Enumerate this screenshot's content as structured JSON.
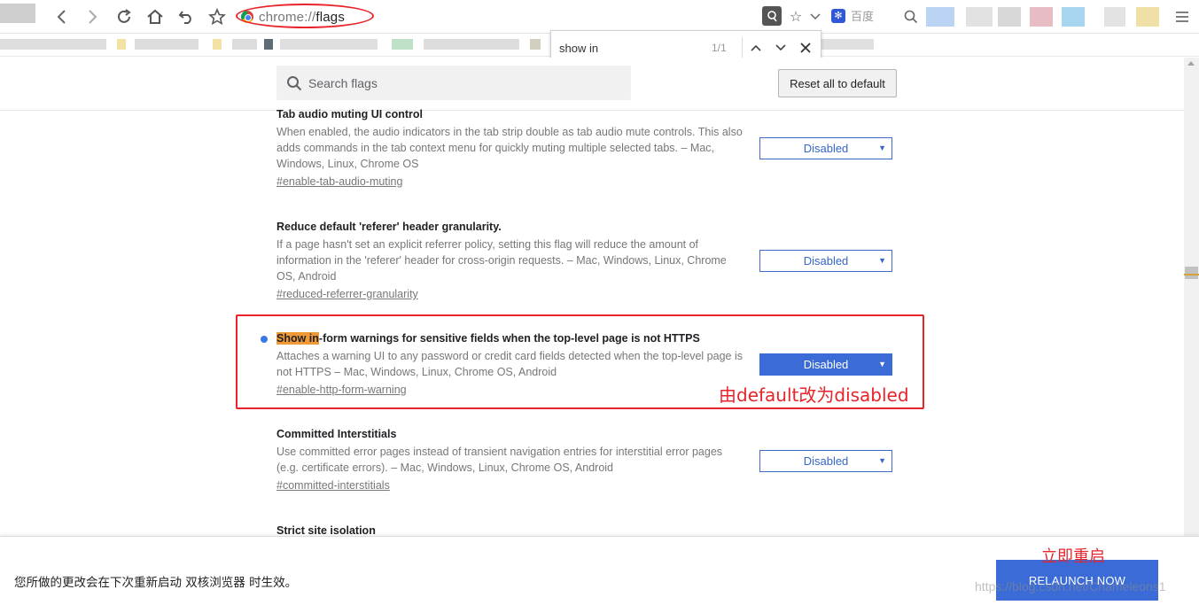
{
  "browser": {
    "url_scheme": "chrome://",
    "url_path": "flags",
    "search_engine": "百度"
  },
  "find_bar": {
    "query": "show in",
    "count": "1/1"
  },
  "header": {
    "search_placeholder": "Search flags",
    "reset_label": "Reset all to default"
  },
  "experiments": [
    {
      "title": "Tab audio muting UI control",
      "description": "When enabled, the audio indicators in the tab strip double as tab audio mute controls. This also adds commands in the tab context menu for quickly muting multiple selected tabs. – Mac, Windows, Linux, Chrome OS",
      "link": "#enable-tab-audio-muting",
      "value": "Disabled"
    },
    {
      "title": "Reduce default 'referer' header granularity.",
      "description": "If a page hasn't set an explicit referrer policy, setting this flag will reduce the amount of information in the 'referer' header for cross-origin requests. – Mac, Windows, Linux, Chrome OS, Android",
      "link": "#reduced-referrer-granularity",
      "value": "Disabled"
    },
    {
      "title_highlight": "Show in",
      "title_rest": "-form warnings for sensitive fields when the top-level page is not HTTPS",
      "description": "Attaches a warning UI to any password or credit card fields detected when the top-level page is not HTTPS – Mac, Windows, Linux, Chrome OS, Android",
      "link": "#enable-http-form-warning",
      "value": "Disabled"
    },
    {
      "title": "Committed Interstitials",
      "description": "Use committed error pages instead of transient navigation entries for interstitial error pages (e.g. certificate errors). – Mac, Windows, Linux, Chrome OS, Android",
      "link": "#committed-interstitials",
      "value": "Disabled"
    },
    {
      "title": "Strict site isolation"
    }
  ],
  "annotations": {
    "changed_note": "由default改为disabled",
    "relaunch_note": "立即重启"
  },
  "bottom": {
    "message": "您所做的更改会在下次重新启动 双核浏览器 时生效。",
    "relaunch_label": "RELAUNCH NOW",
    "watermark": "https://blog.csdn.net/Chameleons1"
  },
  "colors": {
    "accent": "#3b6bd6",
    "annotation_red": "#e8232a",
    "highlight": "#f09a37"
  }
}
